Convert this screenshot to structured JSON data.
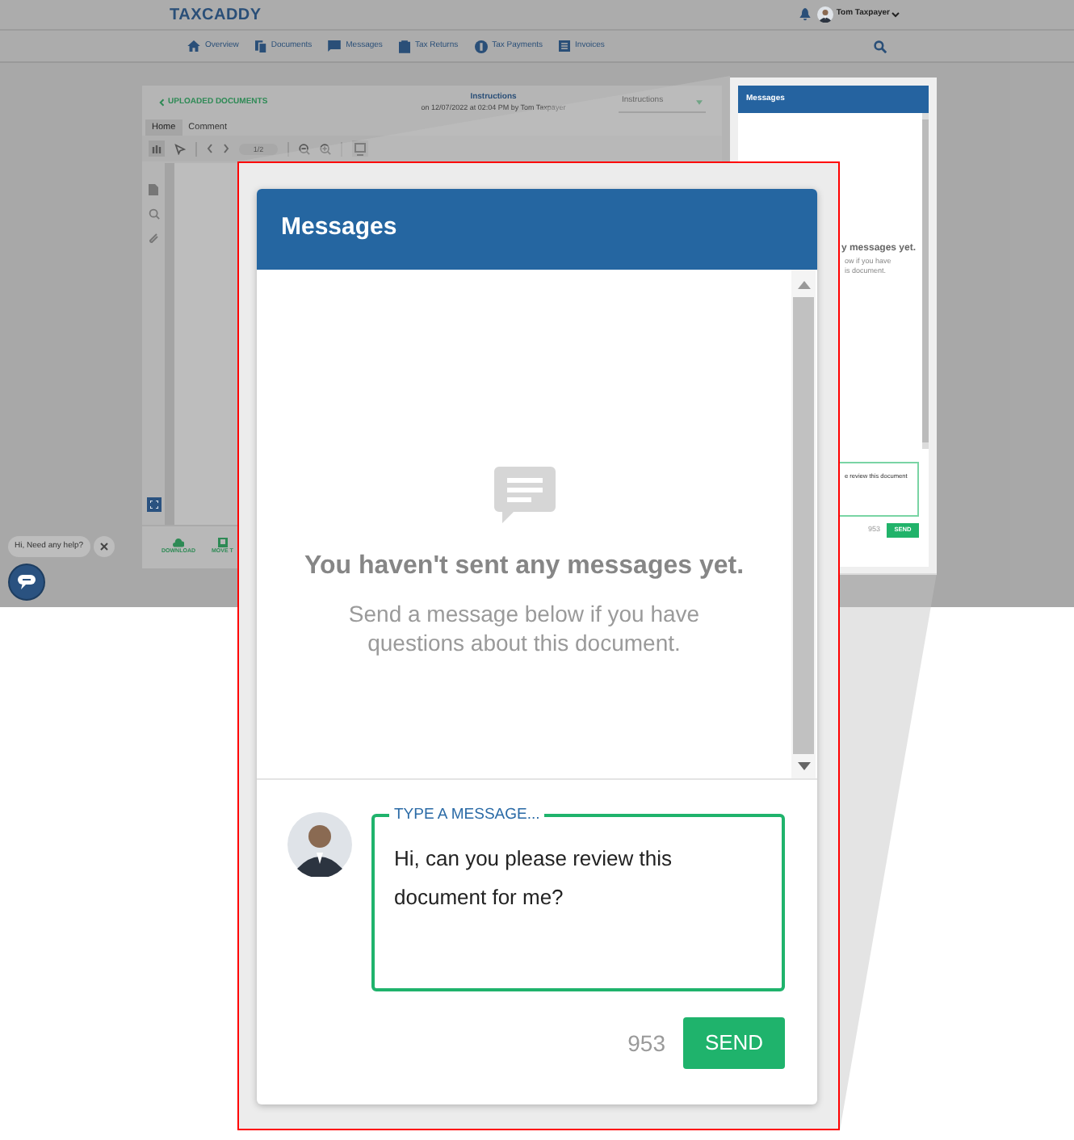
{
  "top_bar": {
    "logo": "TAXCADDY",
    "user": "Tom Taxpayer"
  },
  "nav": [
    {
      "label": "Overview"
    },
    {
      "label": "Documents"
    },
    {
      "label": "Messages"
    },
    {
      "label": "Tax Returns"
    },
    {
      "label": "Tax Payments"
    },
    {
      "label": "Invoices"
    }
  ],
  "document_viewer": {
    "back_link": "UPLOADED DOCUMENTS",
    "title": "Instructions",
    "subtitle": "on 12/07/2022 at 02:04 PM by Tom Taxpayer",
    "dropdown": "Instructions",
    "tabs": [
      {
        "label": "Home",
        "selected": true
      },
      {
        "label": "Comment",
        "selected": false
      }
    ],
    "page_indicator": "1/2",
    "actions": [
      "DOWNLOAD",
      "MOVE T"
    ]
  },
  "side_panel": {
    "title": "Messages",
    "empty_title": "y messages yet.",
    "empty_text_lines": [
      "ow if you have",
      "is document."
    ],
    "message": "e review this document",
    "counter": "953",
    "send": "SEND"
  },
  "help_chat": {
    "bubble": "Hi, Need any help?"
  },
  "callout": {
    "title": "Messages",
    "empty_title": "You haven't sent any messages yet.",
    "empty_text": "Send a message below if you have questions about this document.",
    "message_label": "TYPE A MESSAGE...",
    "message": "Hi, can you please review this document for me?",
    "counter": "953",
    "send": "SEND"
  }
}
